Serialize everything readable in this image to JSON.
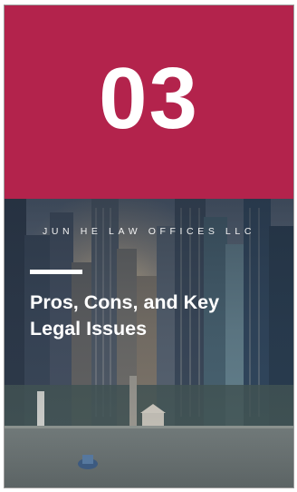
{
  "number": "03",
  "firm_name": "JUN HE LAW OFFICES LLC",
  "headline_line1": "Pros, Cons, and Key",
  "headline_line2": "Legal Issues",
  "colors": {
    "accent": "#b3234c",
    "text": "#ffffff"
  }
}
